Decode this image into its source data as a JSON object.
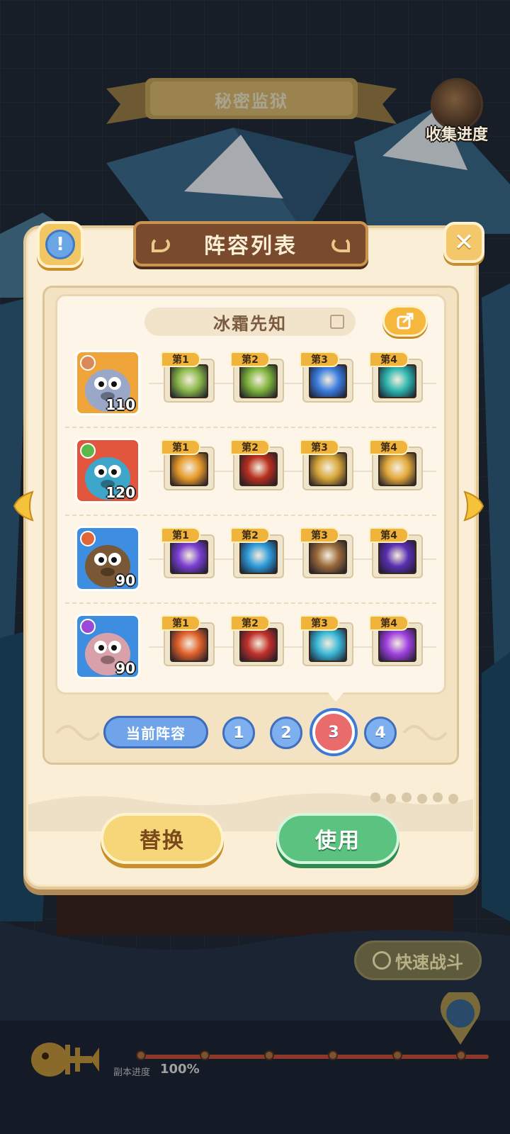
{
  "map": {
    "title": "秘密监狱",
    "collect_label": "收集进度",
    "quick_battle_label": "快速战斗",
    "progress_label": "副本进度",
    "progress_value": "100%",
    "progress_fraction": 1.0
  },
  "dialog": {
    "title": "阵容列表",
    "close_symbol": "✕",
    "info_symbol": "!",
    "lineup_name": "冰霜先知",
    "rows": [
      {
        "hero": {
          "level": "110",
          "frame_color": "#f0a53a",
          "skin": "#9aa7c6",
          "element_color": "#d9885a"
        },
        "skills": [
          {
            "badge": "第1",
            "color": "#8bb84a"
          },
          {
            "badge": "第2",
            "color": "#7fb43c"
          },
          {
            "badge": "第3",
            "color": "#3d7ee0"
          },
          {
            "badge": "第4",
            "color": "#2fb7b0"
          }
        ]
      },
      {
        "hero": {
          "level": "120",
          "frame_color": "#e2563d",
          "skin": "#3da6c9",
          "element_color": "#5cb84a"
        },
        "skills": [
          {
            "badge": "第1",
            "color": "#e89a2a"
          },
          {
            "badge": "第2",
            "color": "#b8301e"
          },
          {
            "badge": "第3",
            "color": "#d8a638"
          },
          {
            "badge": "第4",
            "color": "#e3a93a"
          }
        ]
      },
      {
        "hero": {
          "level": "90",
          "frame_color": "#3d8ee0",
          "skin": "#7a5836",
          "element_color": "#e0663a"
        },
        "skills": [
          {
            "badge": "第1",
            "color": "#7a3fd1"
          },
          {
            "badge": "第2",
            "color": "#2f9ad8"
          },
          {
            "badge": "第3",
            "color": "#9a6a3a"
          },
          {
            "badge": "第4",
            "color": "#5a2fb0"
          }
        ]
      },
      {
        "hero": {
          "level": "90",
          "frame_color": "#3d8ee0",
          "skin": "#d8a0a8",
          "element_color": "#9a4ad8"
        },
        "skills": [
          {
            "badge": "第1",
            "color": "#e0602a"
          },
          {
            "badge": "第2",
            "color": "#c0302a"
          },
          {
            "badge": "第3",
            "color": "#3ab8d8"
          },
          {
            "badge": "第4",
            "color": "#a040e0"
          }
        ]
      }
    ],
    "current_lineup_label": "当前阵容",
    "slots": [
      "1",
      "2",
      "3",
      "4"
    ],
    "active_slot": "3",
    "replace_button": "替换",
    "use_button": "使用"
  }
}
